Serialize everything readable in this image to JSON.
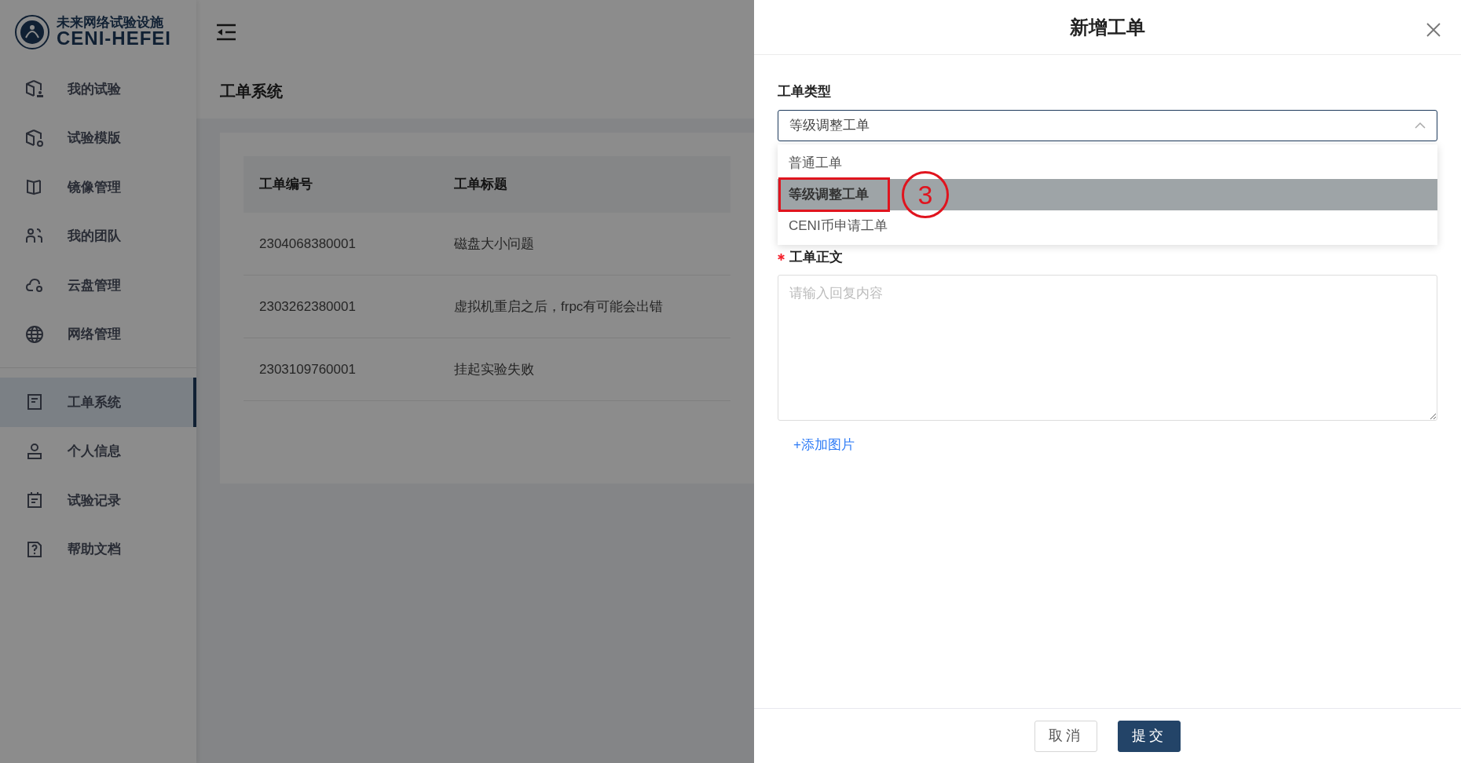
{
  "logo": {
    "title": "未来网络试验设施",
    "subtitle": "CENI-HEFEI"
  },
  "sidebar": {
    "groups": [
      [
        {
          "label": "我的试验",
          "selected": false
        },
        {
          "label": "试验模版",
          "selected": false
        },
        {
          "label": "镜像管理",
          "selected": false
        },
        {
          "label": "我的团队",
          "selected": false
        },
        {
          "label": "云盘管理",
          "selected": false
        },
        {
          "label": "网络管理",
          "selected": false
        }
      ],
      [
        {
          "label": "工单系统",
          "selected": true
        },
        {
          "label": "个人信息",
          "selected": false
        },
        {
          "label": "试验记录",
          "selected": false
        },
        {
          "label": "帮助文档",
          "selected": false
        }
      ]
    ]
  },
  "page": {
    "title": "工单系统"
  },
  "table": {
    "columns": [
      "工单编号",
      "工单标题"
    ],
    "rows": [
      [
        "2304068380001",
        "磁盘大小问题"
      ],
      [
        "2303262380001",
        "虚拟机重启之后，frpc有可能会出错"
      ],
      [
        "2303109760001",
        "挂起实验失败"
      ]
    ]
  },
  "drawer": {
    "title": "新增工单",
    "fields": [
      {
        "kind": "select",
        "label": "工单类型",
        "required": false,
        "value": "等级调整工单",
        "expanded": true,
        "options": [
          {
            "label": "普通工单",
            "selected": false
          },
          {
            "label": "等级调整工单",
            "selected": true
          },
          {
            "label": "CENI币申请工单",
            "selected": false
          }
        ]
      },
      {
        "kind": "textarea",
        "label": "工单正文",
        "required": true,
        "placeholder": "请输入回复内容"
      }
    ],
    "add_image_link": "+添加图片",
    "buttons": [
      {
        "label": "取消",
        "kind": "secondary"
      },
      {
        "label": "提交",
        "kind": "primary"
      }
    ]
  },
  "annotation": {
    "number": "3"
  }
}
